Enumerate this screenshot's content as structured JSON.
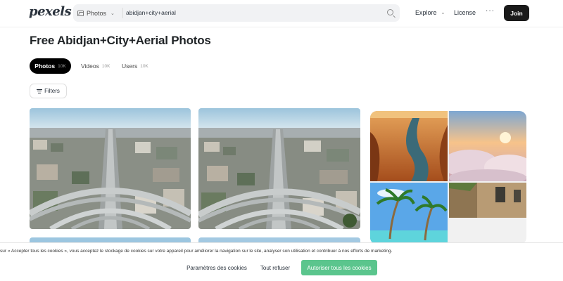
{
  "header": {
    "logo": "pexels",
    "search": {
      "type_label": "Photos",
      "query": "abidjan+city+aerial"
    },
    "nav": {
      "explore": "Explore",
      "license": "License",
      "more": "···",
      "join": "Join"
    }
  },
  "page": {
    "title": "Free Abidjan+City+Aerial Photos"
  },
  "tabs": [
    {
      "label": "Photos",
      "count": "10K",
      "active": true
    },
    {
      "label": "Videos",
      "count": "10K",
      "active": false
    },
    {
      "label": "Users",
      "count": "10K",
      "active": false
    }
  ],
  "filters": {
    "label": "Filters"
  },
  "cookie_banner": {
    "text": "sur « Accepter tous les cookies », vous acceptez le stockage de cookies sur votre appareil pour améliorer la navigation sur le site, analyser son utilisation et contribuer à nos efforts de marketing.",
    "preferences": "Paramètres des cookies",
    "refuse": "Tout refuser",
    "accept": "Autoriser tous les cookies"
  },
  "colors": {
    "accent_green": "#5bc58d",
    "dark": "#1a1a1a"
  }
}
